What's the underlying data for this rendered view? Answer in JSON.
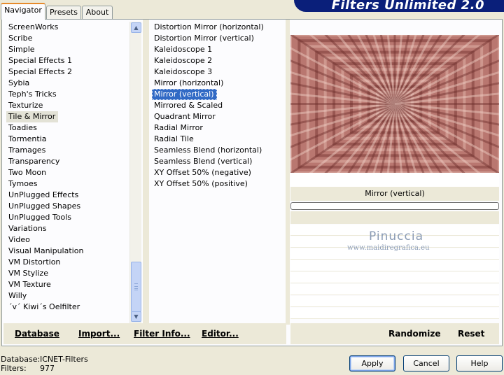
{
  "tabs": [
    {
      "label": "Navigator",
      "active": true
    },
    {
      "label": "Presets",
      "active": false
    },
    {
      "label": "About",
      "active": false
    }
  ],
  "banner": {
    "title": "Filters Unlimited 2.0"
  },
  "categories": {
    "items": [
      "ScreenWorks",
      "Scribe",
      "Simple",
      "Special Effects 1",
      "Special Effects 2",
      "Sybia",
      "Teph's Tricks",
      "Texturize",
      "Tile & Mirror",
      "Toadies",
      "Tormentia",
      "Tramages",
      "Transparency",
      "Two Moon",
      "Tymoes",
      "UnPlugged Effects",
      "UnPlugged Shapes",
      "UnPlugged Tools",
      "Variations",
      "Video",
      "Visual Manipulation",
      "VM Distortion",
      "VM Stylize",
      "VM Texture",
      "Willy",
      "´v´ Kiwi´s Oelfilter"
    ],
    "selected": "Tile & Mirror"
  },
  "filters": {
    "items": [
      "Distortion Mirror (horizontal)",
      "Distortion Mirror (vertical)",
      "Kaleidoscope 1",
      "Kaleidoscope 2",
      "Kaleidoscope 3",
      "Mirror (horizontal)",
      "Mirror (vertical)",
      "Mirrored & Scaled",
      "Quadrant Mirror",
      "Radial Mirror",
      "Radial Tile",
      "Seamless Blend (horizontal)",
      "Seamless Blend (vertical)",
      "XY Offset 50% (negative)",
      "XY Offset 50% (positive)"
    ],
    "selected": "Mirror (vertical)"
  },
  "preview": {
    "caption": "Mirror (vertical)",
    "color": "#b97770"
  },
  "watermark": {
    "name": "Pinuccia",
    "site": "www.maidiregrafica.eu"
  },
  "bottom_bar": {
    "database": "Database",
    "import": "Import...",
    "filter_info": "Filter Info...",
    "editor": "Editor...",
    "randomize": "Randomize",
    "reset": "Reset"
  },
  "status": {
    "database_label": "Database:",
    "database_value": "ICNET-Filters",
    "filters_label": "Filters:",
    "filters_value": "977"
  },
  "buttons": {
    "apply": "Apply",
    "cancel": "Cancel",
    "help": "Help"
  },
  "icons": {
    "scroll_up": "chevron-up-icon",
    "scroll_down": "chevron-down-icon"
  }
}
